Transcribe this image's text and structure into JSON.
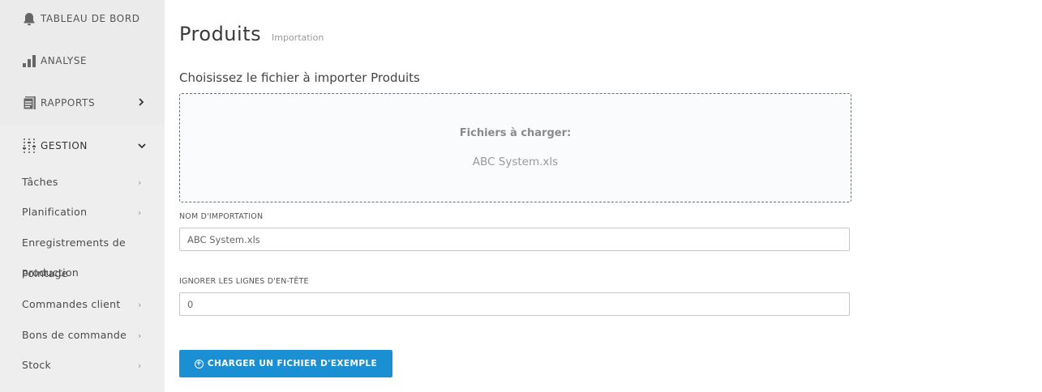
{
  "sidebar": {
    "top_items": [
      {
        "label": "TABLEAU DE BORD",
        "icon": "bell-icon"
      },
      {
        "label": "ANALYSE",
        "icon": "bar-chart-icon"
      },
      {
        "label": "RAPPORTS",
        "icon": "reports-icon"
      }
    ],
    "section": {
      "label": "GESTION",
      "icon": "sliders-icon"
    },
    "sub_items": [
      {
        "label": "Tâches"
      },
      {
        "label": "Planification"
      },
      {
        "label": "Enregistrements de"
      },
      {
        "label": "production"
      },
      {
        "label": "Pointage"
      },
      {
        "label": "Commandes client"
      },
      {
        "label": "Bons de commande"
      },
      {
        "label": "Stock"
      }
    ]
  },
  "main": {
    "title": "Produits",
    "subtitle": "Importation",
    "choose_label": "Choisissez le fichier à importer Produits",
    "dropzone": {
      "heading": "Fichiers à charger:",
      "file": "ABC System.xls"
    },
    "import_name": {
      "label": "NOM D'IMPORTATION",
      "value": "ABC System.xls"
    },
    "skip_header": {
      "label": "IGNORER LES LIGNES D'EN-TÊTE",
      "value": "0"
    },
    "button_label": "CHARGER UN FICHIER D'EXEMPLE"
  }
}
